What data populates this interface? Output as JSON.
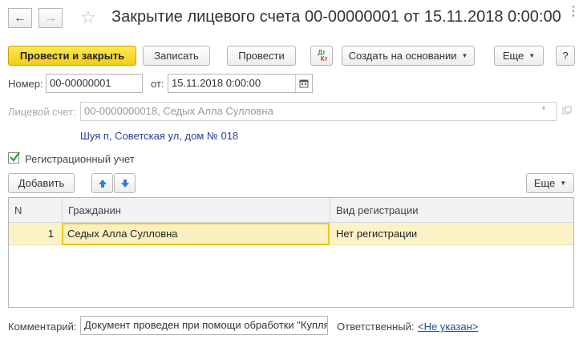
{
  "toolbar": {
    "back_icon": "arrow-left-icon",
    "forward_icon": "arrow-right-icon",
    "favorite_icon": "star-icon",
    "title": "Закрытие лицевого счета 00-00000001 от 15.11.2018 0:00:00",
    "more_icon": "more-vertical-icon",
    "post_close_label": "Провести и закрыть",
    "save_label": "Записать",
    "post_label": "Провести",
    "dtkt_label_top": "Дт",
    "dtkt_label_bottom": "Кт",
    "create_based_label": "Создать на основании",
    "more_label": "Еще",
    "help_label": "?"
  },
  "form": {
    "number_label": "Номер:",
    "number_value": "00-00000001",
    "from_label": "от:",
    "date_value": "15.11.2018  0:00:00",
    "account_label": "Лицевой счет:",
    "account_value": "00-0000000018, Седых Алла Сулловна",
    "address": "Шуя п, Советская ул, дом № 018",
    "registration_label": "Регистрационный учет",
    "registration_checked": true
  },
  "table_toolbar": {
    "add_label": "Добавить",
    "more_label": "Еще"
  },
  "table": {
    "columns": [
      "N",
      "Гражданин",
      "Вид регистрации"
    ],
    "rows": [
      {
        "n": "1",
        "citizen": "Седых Алла Сулловна",
        "reg_type": "Нет регистрации"
      }
    ]
  },
  "footer": {
    "comment_label": "Комментарий:",
    "comment_value": "Документ проведен при помощи обработки \"Купля",
    "responsible_label": "Ответственный:",
    "responsible_value": "<Не указан>"
  },
  "colors": {
    "primary": "#f2cd13",
    "row_highlight": "#fbf2c6",
    "link": "#1a4f96"
  }
}
